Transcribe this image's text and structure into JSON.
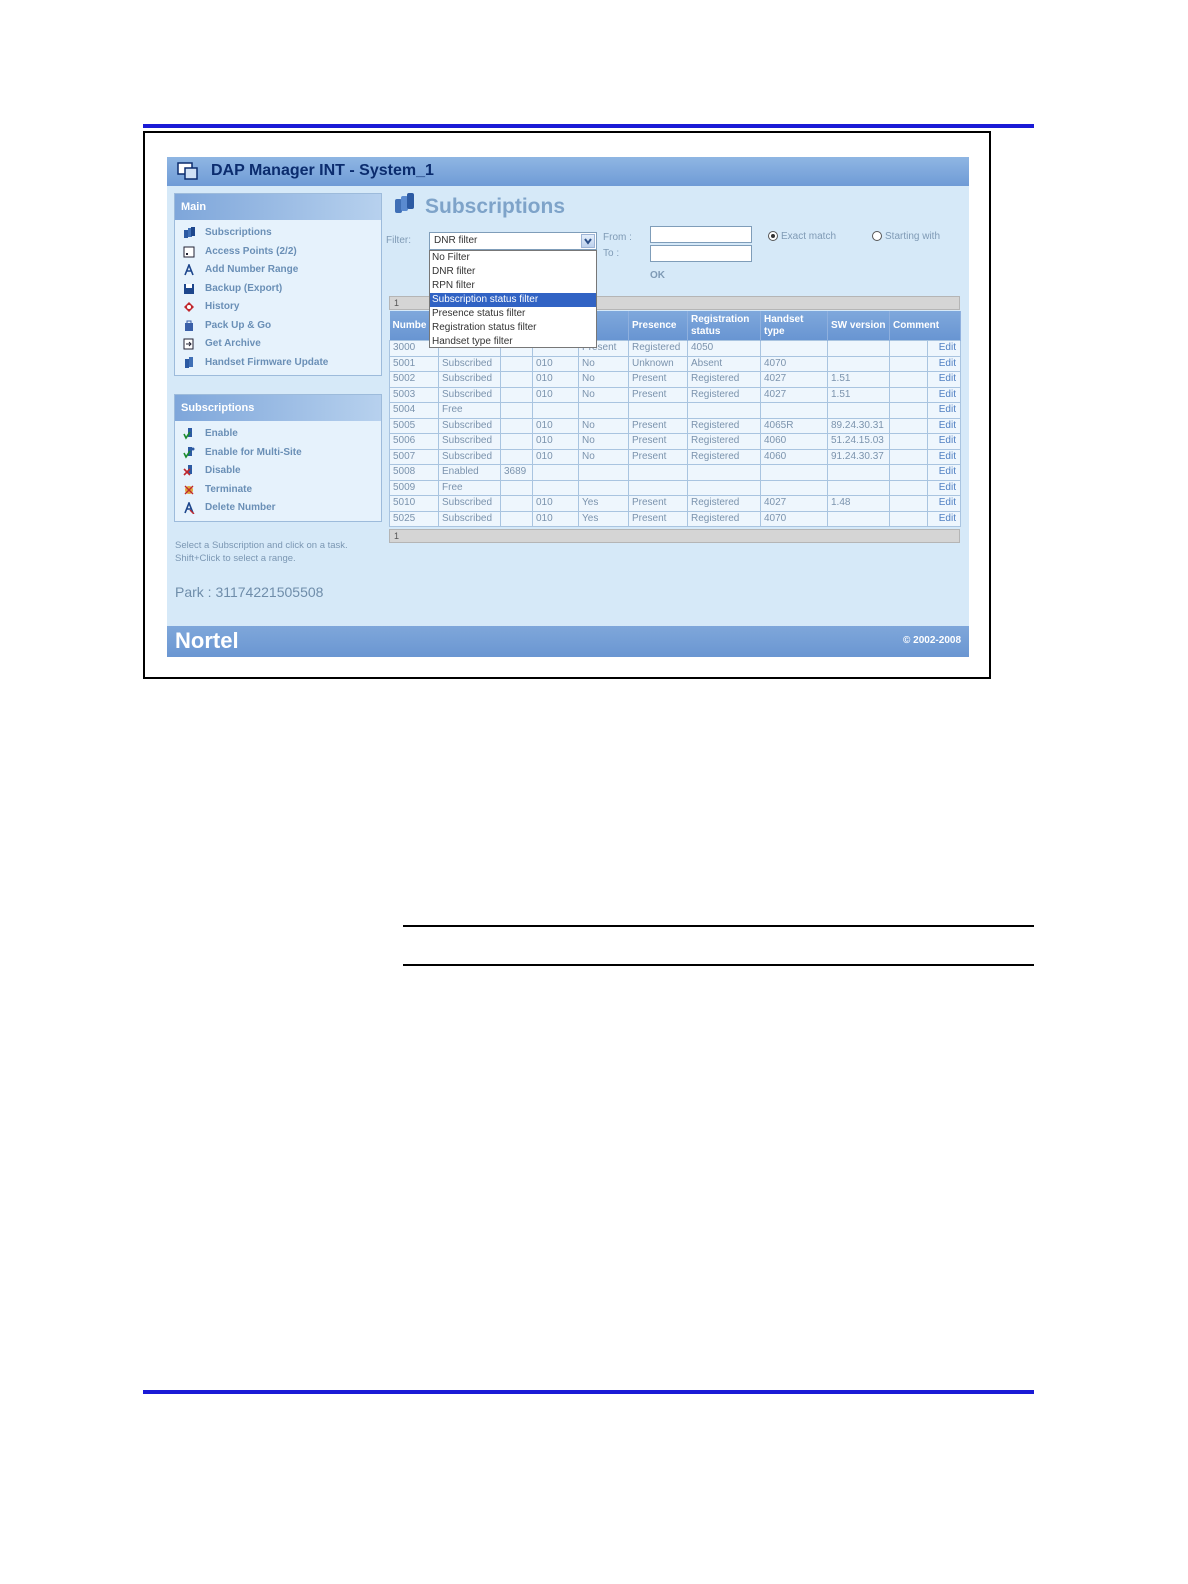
{
  "app": {
    "title": "DAP Manager INT - System_1",
    "brand": "Nortel",
    "copyright": "© 2002-2008"
  },
  "sidebar": {
    "main": {
      "header": "Main",
      "items": [
        {
          "label": "Subscriptions",
          "icon": "subscriptions-icon"
        },
        {
          "label": "Access Points (2/2)",
          "icon": "access-points-icon"
        },
        {
          "label": "Add Number Range",
          "icon": "add-number-icon"
        },
        {
          "label": "Backup (Export)",
          "icon": "disk-icon"
        },
        {
          "label": "History",
          "icon": "history-icon"
        },
        {
          "label": "Pack Up & Go",
          "icon": "package-icon"
        },
        {
          "label": "Get Archive",
          "icon": "archive-icon"
        },
        {
          "label": "Handset Firmware Update",
          "icon": "firmware-icon"
        }
      ]
    },
    "subscriptions": {
      "header": "Subscriptions",
      "items": [
        {
          "label": "Enable",
          "icon": "enable-icon"
        },
        {
          "label": "Enable for Multi-Site",
          "icon": "enable-multisite-icon"
        },
        {
          "label": "Disable",
          "icon": "disable-icon"
        },
        {
          "label": "Terminate",
          "icon": "terminate-icon"
        },
        {
          "label": "Delete Number",
          "icon": "delete-number-icon"
        }
      ]
    },
    "hint_line1": "Select a Subscription and click on a task.",
    "hint_line2": "Shift+Click to select a range.",
    "park": "Park : 31174221505508"
  },
  "main": {
    "title": "Subscriptions",
    "filter": {
      "label": "Filter:",
      "selected": "DNR filter",
      "options": [
        "No Filter",
        "DNR filter",
        "RPN filter",
        "Subscription status filter",
        "Presence status filter",
        "Registration status filter",
        "Handset type filter"
      ],
      "highlighted": "Subscription status filter",
      "from_label": "From :",
      "to_label": "To :",
      "exact_match": "Exact match",
      "starting_with": "Starting with",
      "ok": "OK"
    },
    "pager_top": "1",
    "pager_bottom": "1",
    "table": {
      "headers": [
        "Numbe",
        "",
        "",
        "lti-",
        "Presence",
        "Registration status",
        "Handset type",
        "SW version",
        "Comment",
        ""
      ],
      "rows": [
        [
          "3000",
          "",
          "",
          "",
          "Present",
          "Registered",
          "4050",
          "",
          "",
          "Edit"
        ],
        [
          "5001",
          "Subscribed",
          "",
          "010",
          "No",
          "Unknown",
          "Absent",
          "4070",
          "",
          "",
          "Edit"
        ],
        [
          "5002",
          "Subscribed",
          "",
          "010",
          "No",
          "Present",
          "Registered",
          "4027",
          "1.51",
          "",
          "Edit"
        ],
        [
          "5003",
          "Subscribed",
          "",
          "010",
          "No",
          "Present",
          "Registered",
          "4027",
          "1.51",
          "",
          "Edit"
        ],
        [
          "5004",
          "Free",
          "",
          "",
          "",
          "",
          "",
          "",
          "",
          "",
          "Edit"
        ],
        [
          "5005",
          "Subscribed",
          "",
          "010",
          "No",
          "Present",
          "Registered",
          "4065R",
          "89.24.30.31",
          "",
          "Edit"
        ],
        [
          "5006",
          "Subscribed",
          "",
          "010",
          "No",
          "Present",
          "Registered",
          "4060",
          "51.24.15.03",
          "",
          "Edit"
        ],
        [
          "5007",
          "Subscribed",
          "",
          "010",
          "No",
          "Present",
          "Registered",
          "4060",
          "91.24.30.37",
          "",
          "Edit"
        ],
        [
          "5008",
          "Enabled",
          "3689",
          "",
          "",
          "",
          "",
          "",
          "",
          "",
          "Edit"
        ],
        [
          "5009",
          "Free",
          "",
          "",
          "",
          "",
          "",
          "",
          "",
          "",
          "Edit"
        ],
        [
          "5010",
          "Subscribed",
          "",
          "010",
          "Yes",
          "Present",
          "Registered",
          "4027",
          "1.48",
          "",
          "Edit"
        ],
        [
          "5025",
          "Subscribed",
          "",
          "010",
          "Yes",
          "Present",
          "Registered",
          "4070",
          "",
          "",
          "Edit"
        ]
      ]
    }
  },
  "colors": {
    "rule": "#1a1ad6",
    "header_blue": "#6f9bd6",
    "background": "#d6e9f8"
  }
}
